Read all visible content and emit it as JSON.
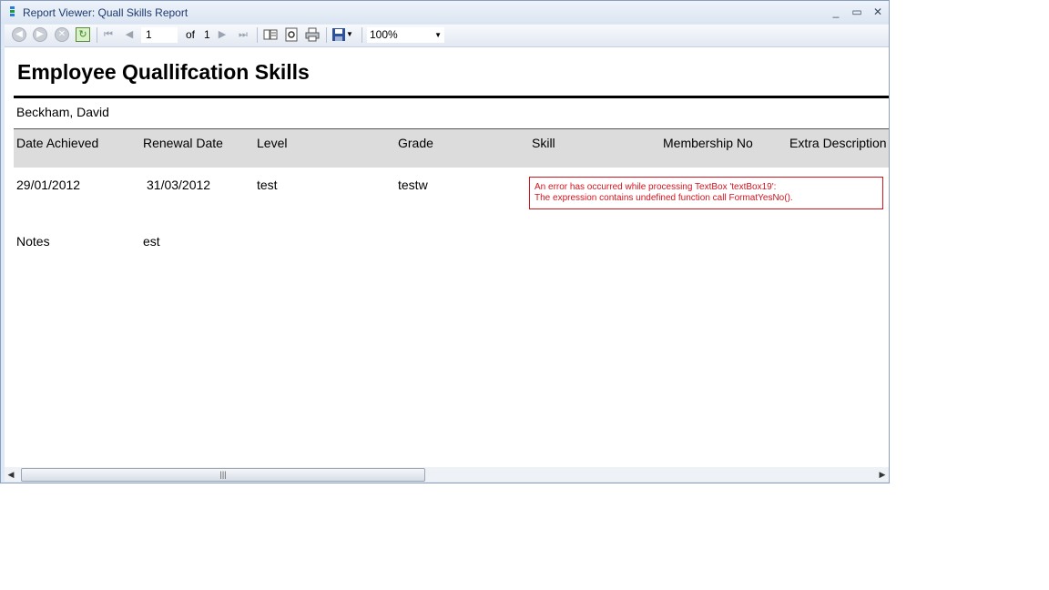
{
  "window": {
    "title": "Report Viewer: Quall Skills  Report",
    "minimize": "_",
    "maximize": "▭",
    "close": "✕"
  },
  "toolbar": {
    "page_current": "1",
    "page_of": "of",
    "page_total": "1",
    "zoom": "100%",
    "icons": [
      "back-icon",
      "forward-icon",
      "stop-icon",
      "refresh-icon",
      "first-page-icon",
      "previous-page-icon",
      "next-page-icon",
      "last-page-icon",
      "document-map-icon",
      "print-preview-icon",
      "print-icon",
      "save-icon"
    ]
  },
  "report": {
    "title": "Employee Quallifcation Skills",
    "employee": "Beckham, David",
    "columns": [
      "Date Achieved",
      "Renewal Date",
      "Level",
      "Grade",
      "Skill",
      "Membership No",
      "Extra Description"
    ],
    "row": {
      "date_achieved": "29/01/2012",
      "renewal_date": "31/03/2012",
      "level": "test",
      "grade": "testw"
    },
    "error_line1": "An error has occurred while processing TextBox 'textBox19':",
    "error_line2": "The expression contains undefined function call FormatYesNo().",
    "notes_label": "Notes",
    "notes_value": "est"
  },
  "colors": {
    "error": "#d2141e",
    "header_bg": "#dcdcdc"
  }
}
